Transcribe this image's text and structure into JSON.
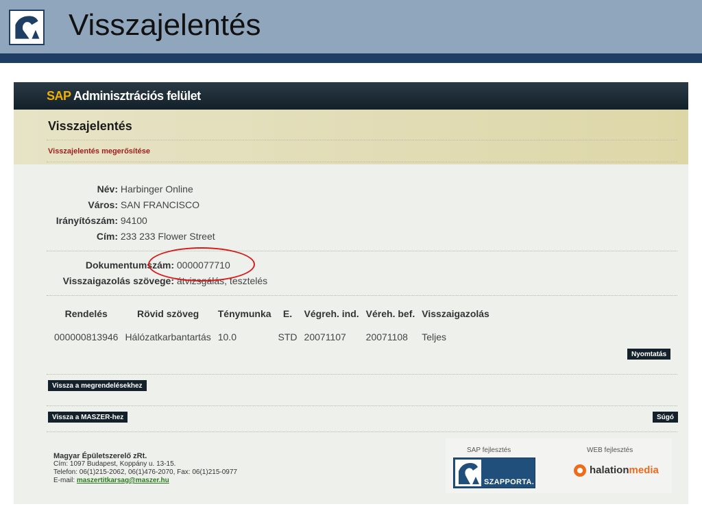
{
  "slide": {
    "title": "Visszajelentés"
  },
  "sap": {
    "brand_prefix": "SAP",
    "brand_suffix": "Adminisztrációs felület",
    "page_heading": "Visszajelentés",
    "sub_heading": "Visszajelentés megerősítése"
  },
  "fields": {
    "name_label": "Név:",
    "name_value": "Harbinger Online",
    "city_label": "Város:",
    "city_value": "SAN FRANCISCO",
    "zip_label": "Irányítószám:",
    "zip_value": "94100",
    "address_label": "Cím:",
    "address_value": "233 233 Flower Street",
    "doc_label": "Dokumentumszám:",
    "doc_value": "0000077710",
    "confirm_label": "Visszaigazolás szövege:",
    "confirm_value": "átvizsgálás, tesztelés"
  },
  "table": {
    "headers": [
      "Rendelés",
      "Rövid szöveg",
      "Ténymunka",
      "E.",
      "Végreh. ind.",
      "Véreh. bef.",
      "Visszaigazolás"
    ],
    "rows": [
      [
        "000000813946",
        "Hálózatkarbantartás",
        "10.0",
        "STD",
        "20071107",
        "20071108",
        "Teljes"
      ]
    ]
  },
  "buttons": {
    "print": "Nyomtatás",
    "back_orders": "Vissza a megrendelésekhez",
    "back_maszer": "Vissza a MASZER-hez",
    "help": "Súgó"
  },
  "footer": {
    "company_name": "Magyar Épületszerelő zRt.",
    "address": "Cím: 1097 Budapest, Koppány u. 13-15.",
    "phone": "Telefon: 06(1)215-2062, 06(1)476-2070, Fax: 06(1)215-0977",
    "email_label": "E-mail:",
    "email": "maszertitkarsag@maszer.hu",
    "sap_dev_caption": "SAP fejlesztés",
    "web_dev_caption": "WEB fejlesztés",
    "szapporta_logo": "SZAPPORTA.",
    "halation_logo_a": "halation",
    "halation_logo_b": "media"
  },
  "colors": {
    "slide_bar": "#8fa6bd",
    "accent_dark": "#1f3e63",
    "sap_gold": "#f0b000",
    "annotation_red": "#d81a1a"
  }
}
